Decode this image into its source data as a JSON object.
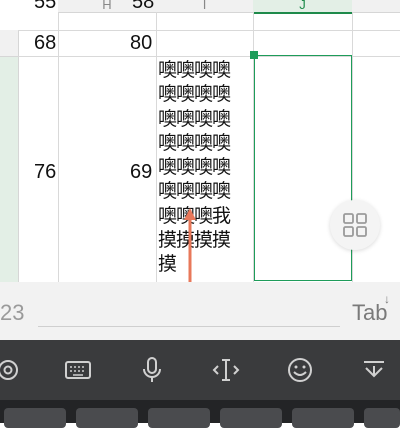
{
  "sheet": {
    "column_headers": [
      "H",
      "I",
      "J"
    ],
    "top_partial_row": [
      "55",
      "58"
    ],
    "rows": [
      {
        "g": "68",
        "h": "80"
      },
      {
        "g": "76",
        "h": "69"
      }
    ],
    "wrapped_text_lines": [
      "噢噢噢噢",
      "噢噢噢噢",
      "噢噢噢噢",
      "噢噢噢噢",
      "噢噢噢噢",
      "噢噢噢噢",
      "噢噢噢我",
      "摸摸摸摸",
      "摸"
    ]
  },
  "input_bar": {
    "value": "23",
    "tab_label": "Tab"
  },
  "keyboard_toolbar": {
    "icons": [
      "settings-icon",
      "keyboard-icon",
      "microphone-icon",
      "cursor-icon",
      "emoji-icon",
      "collapse-keyboard-icon"
    ]
  },
  "colors": {
    "accent": "#1e9c5a",
    "annotation_arrow": "#e8785a",
    "toolbar_bg": "#3a3b3d"
  }
}
